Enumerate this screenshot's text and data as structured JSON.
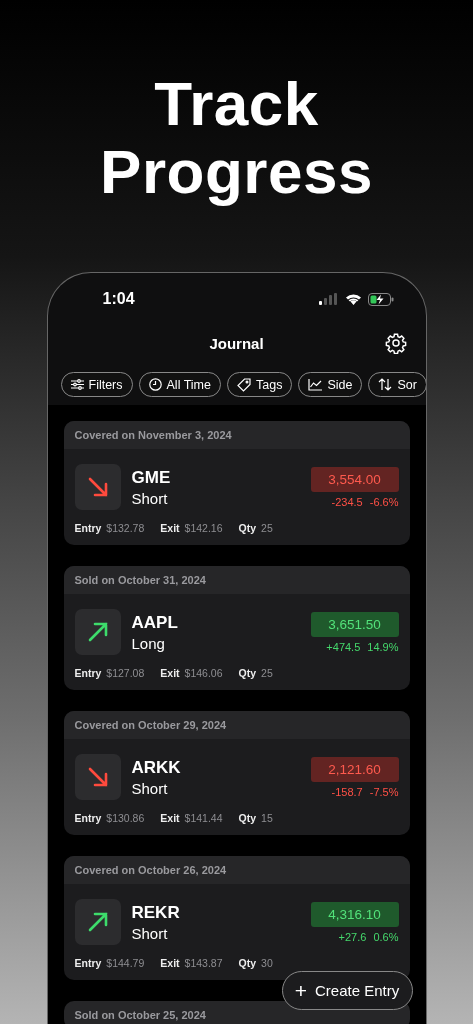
{
  "headline": [
    "Track",
    "Progress"
  ],
  "status_bar": {
    "time": "1:04"
  },
  "nav": {
    "title": "Journal"
  },
  "chips": [
    {
      "kind": "filters",
      "label": "Filters"
    },
    {
      "kind": "time",
      "label": "All Time"
    },
    {
      "kind": "tags",
      "label": "Tags"
    },
    {
      "kind": "side",
      "label": "Side"
    },
    {
      "kind": "sort",
      "label": "Sor"
    }
  ],
  "trades": [
    {
      "kind": "loss",
      "date": "Covered on November 3, 2024",
      "ticker": "GME",
      "side": "Short",
      "value": "3,554.00",
      "change": "-234.5",
      "percent": "-6.6%",
      "entry_label": "Entry",
      "entry": "$132.78",
      "exit_label": "Exit",
      "exit": "$142.16",
      "qty_label": "Qty",
      "qty": "25"
    },
    {
      "kind": "gain",
      "date": "Sold on October 31, 2024",
      "ticker": "AAPL",
      "side": "Long",
      "value": "3,651.50",
      "change": "+474.5",
      "percent": "14.9%",
      "entry_label": "Entry",
      "entry": "$127.08",
      "exit_label": "Exit",
      "exit": "$146.06",
      "qty_label": "Qty",
      "qty": "25"
    },
    {
      "kind": "loss",
      "date": "Covered on October 29, 2024",
      "ticker": "ARKK",
      "side": "Short",
      "value": "2,121.60",
      "change": "-158.7",
      "percent": "-7.5%",
      "entry_label": "Entry",
      "entry": "$130.86",
      "exit_label": "Exit",
      "exit": "$141.44",
      "qty_label": "Qty",
      "qty": "15"
    },
    {
      "kind": "gain",
      "date": "Covered on October 26, 2024",
      "ticker": "REKR",
      "side": "Short",
      "value": "4,316.10",
      "change": "+27.6",
      "percent": "0.6%",
      "entry_label": "Entry",
      "entry": "$144.79",
      "exit_label": "Exit",
      "exit": "$143.87",
      "qty_label": "Qty",
      "qty": "30"
    },
    {
      "kind": "partial",
      "date": "Sold on October 25, 2024"
    }
  ],
  "create_button": {
    "label": "Create Entry",
    "icon": "+"
  }
}
